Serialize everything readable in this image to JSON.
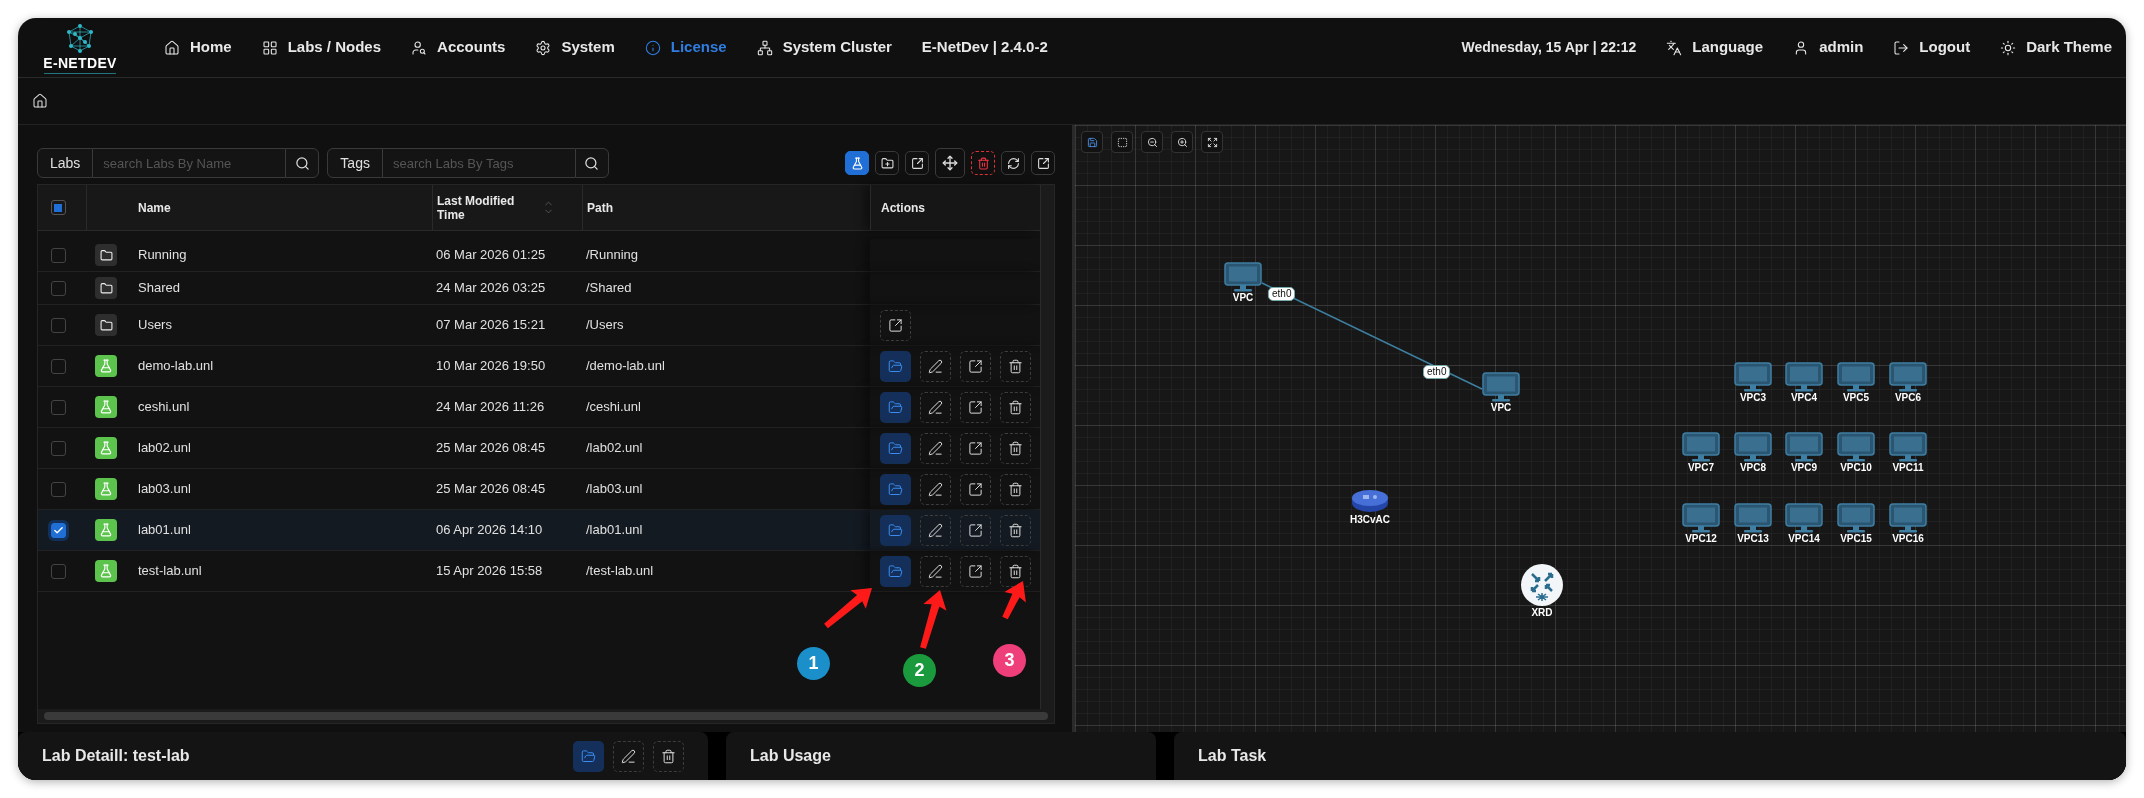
{
  "nav": {
    "logo_text": "E-NETDEV",
    "items": [
      {
        "label": "Home",
        "kind": "home",
        "selected": false
      },
      {
        "label": "Labs / Nodes",
        "kind": "grid",
        "selected": false
      },
      {
        "label": "Accounts",
        "kind": "accounts",
        "selected": false
      },
      {
        "label": "System",
        "kind": "settings",
        "selected": false
      },
      {
        "label": "License",
        "kind": "info",
        "selected": true
      },
      {
        "label": "System Cluster",
        "kind": "cluster",
        "selected": false
      }
    ],
    "version": "E-NetDev | 2.4.0-2",
    "datetime": "Wednesday, 15 Apr | 22:12",
    "right_items": [
      {
        "label": "Language",
        "kind": "language"
      },
      {
        "label": "admin",
        "kind": "user"
      },
      {
        "label": "Logout",
        "kind": "logout"
      },
      {
        "label": "Dark Theme",
        "kind": "sun"
      }
    ]
  },
  "search": [
    {
      "label": "Labs",
      "placeholder": "search Labs By Name"
    },
    {
      "label": "Tags",
      "placeholder": "search Labs By Tags"
    }
  ],
  "toolbar": [
    {
      "kind": "flask",
      "selected": true
    },
    {
      "kind": "folder-plus",
      "selected": false
    },
    {
      "kind": "export",
      "selected": false
    },
    {
      "kind": "move",
      "selected": false
    },
    {
      "kind": "delete",
      "selected": false
    },
    {
      "kind": "refresh",
      "selected": false
    },
    {
      "kind": "export",
      "selected": false
    }
  ],
  "table": {
    "header_checkbox": {
      "checked": false,
      "indeterminate": true
    },
    "columns": [
      {
        "label": "Name",
        "sortable": false
      },
      {
        "label": "Last Modified Time",
        "sortable": true
      },
      {
        "label": "Path",
        "sortable": false
      },
      {
        "label": "Actions",
        "sortable": false
      }
    ],
    "rows": [
      {
        "kind": "folder",
        "name": "Running",
        "modified": "06 Mar 2026 01:25",
        "path": "/Running",
        "checked": false,
        "actions": []
      },
      {
        "kind": "folder",
        "name": "Shared",
        "modified": "24 Mar 2026 03:25",
        "path": "/Shared",
        "checked": false,
        "actions": []
      },
      {
        "kind": "folder",
        "name": "Users",
        "modified": "07 Mar 2026 15:21",
        "path": "/Users",
        "checked": false,
        "actions": [
          {
            "kind": "export"
          }
        ]
      },
      {
        "kind": "lab",
        "name": "demo-lab.unl",
        "modified": "10 Mar 2026 19:50",
        "path": "/demo-lab.unl",
        "checked": false,
        "actions": [
          {
            "kind": "open"
          },
          {
            "kind": "edit"
          },
          {
            "kind": "export"
          },
          {
            "kind": "delete"
          }
        ]
      },
      {
        "kind": "lab",
        "name": "ceshi.unl",
        "modified": "24 Mar 2026 11:26",
        "path": "/ceshi.unl",
        "checked": false,
        "actions": [
          {
            "kind": "open"
          },
          {
            "kind": "edit"
          },
          {
            "kind": "export"
          },
          {
            "kind": "delete"
          }
        ]
      },
      {
        "kind": "lab",
        "name": "lab02.unl",
        "modified": "25 Mar 2026 08:45",
        "path": "/lab02.unl",
        "checked": false,
        "actions": [
          {
            "kind": "open"
          },
          {
            "kind": "edit"
          },
          {
            "kind": "export"
          },
          {
            "kind": "delete"
          }
        ]
      },
      {
        "kind": "lab",
        "name": "lab03.unl",
        "modified": "25 Mar 2026 08:45",
        "path": "/lab03.unl",
        "checked": false,
        "actions": [
          {
            "kind": "open"
          },
          {
            "kind": "edit"
          },
          {
            "kind": "export"
          },
          {
            "kind": "delete"
          }
        ]
      },
      {
        "kind": "lab",
        "name": "lab01.unl",
        "modified": "06 Apr 2026 14:10",
        "path": "/lab01.unl",
        "checked": true,
        "actions": [
          {
            "kind": "open"
          },
          {
            "kind": "edit"
          },
          {
            "kind": "export"
          },
          {
            "kind": "delete"
          }
        ]
      },
      {
        "kind": "lab",
        "name": "test-lab.unl",
        "modified": "15 Apr 2026 15:58",
        "path": "/test-lab.unl",
        "checked": false,
        "actions": [
          {
            "kind": "open"
          },
          {
            "kind": "edit"
          },
          {
            "kind": "export"
          },
          {
            "kind": "delete"
          }
        ]
      }
    ]
  },
  "canvas": {
    "toolbar": [
      {
        "kind": "save"
      },
      {
        "kind": "select"
      },
      {
        "kind": "zoom-out"
      },
      {
        "kind": "zoom-in"
      },
      {
        "kind": "fit"
      }
    ],
    "nodes": [
      {
        "kind": "vpc",
        "label": "VPC"
      },
      {
        "kind": "vpc",
        "label": "VPC"
      },
      {
        "kind": "vpc",
        "label": "VPC3"
      },
      {
        "kind": "vpc",
        "label": "VPC4"
      },
      {
        "kind": "vpc",
        "label": "VPC5"
      },
      {
        "kind": "vpc",
        "label": "VPC6"
      },
      {
        "kind": "vpc",
        "label": "VPC7"
      },
      {
        "kind": "vpc",
        "label": "VPC8"
      },
      {
        "kind": "vpc",
        "label": "VPC9"
      },
      {
        "kind": "vpc",
        "label": "VPC10"
      },
      {
        "kind": "vpc",
        "label": "VPC11"
      },
      {
        "kind": "vpc",
        "label": "VPC12"
      },
      {
        "kind": "vpc",
        "label": "VPC13"
      },
      {
        "kind": "vpc",
        "label": "VPC14"
      },
      {
        "kind": "vpc",
        "label": "VPC15"
      },
      {
        "kind": "vpc",
        "label": "VPC16"
      },
      {
        "kind": "switch",
        "label": "H3CvAC"
      },
      {
        "kind": "router",
        "label": "XRD"
      }
    ],
    "links": [
      {
        "source_port": "eth0",
        "target_port": "eth0"
      }
    ]
  },
  "annotations": [
    {
      "label": "1",
      "color": "#1a8fc9"
    },
    {
      "label": "2",
      "color": "#1a9a3c"
    },
    {
      "label": "3",
      "color": "#ee3f7a"
    }
  ],
  "bottom_panels": [
    {
      "title": "Lab Detaill: test-lab",
      "actions": [
        {
          "kind": "open"
        },
        {
          "kind": "edit"
        },
        {
          "kind": "delete"
        }
      ]
    },
    {
      "title": "Lab Usage"
    },
    {
      "title": "Lab Task"
    }
  ]
}
